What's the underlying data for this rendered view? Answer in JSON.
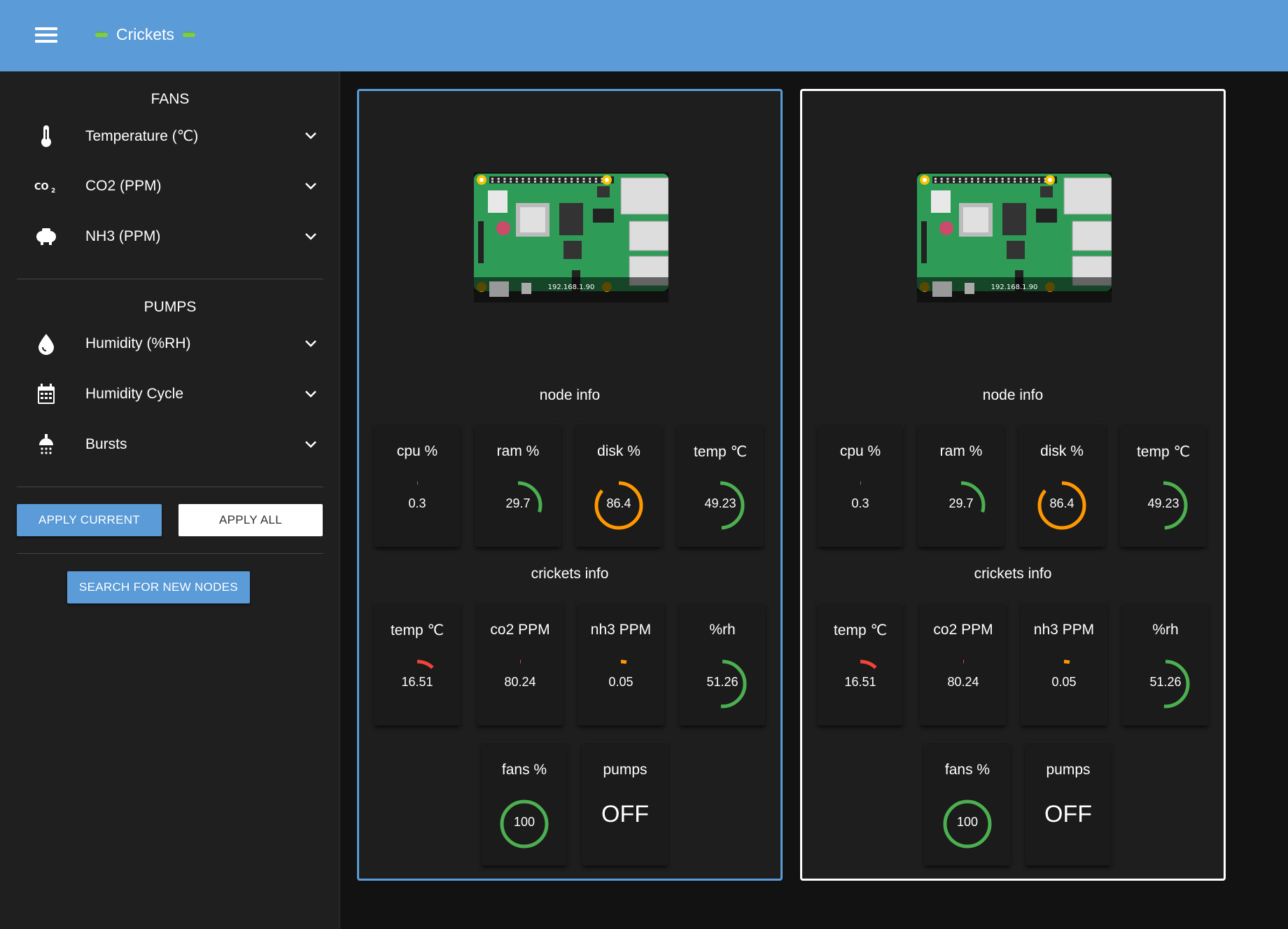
{
  "app": {
    "title": "Crickets"
  },
  "sidebar": {
    "fans_title": "FANS",
    "fans": [
      {
        "label": "Temperature (℃)",
        "icon": "thermometer-icon"
      },
      {
        "label": "CO2 (PPM)",
        "icon": "co2-icon"
      },
      {
        "label": "NH3 (PPM)",
        "icon": "nh3-gas-icon"
      }
    ],
    "pumps_title": "PUMPS",
    "pumps": [
      {
        "label": "Humidity (%RH)",
        "icon": "water-drop-icon"
      },
      {
        "label": "Humidity Cycle",
        "icon": "calendar-icon"
      },
      {
        "label": "Bursts",
        "icon": "sprinkler-icon"
      }
    ],
    "apply_current": "APPLY CURRENT",
    "apply_all": "APPLY ALL",
    "search_nodes": "SEARCH FOR NEW NODES"
  },
  "colors": {
    "accent": "#5a9bd8",
    "green": "#4caf50",
    "orange": "#ff9800",
    "red": "#f44336"
  },
  "nodes": [
    {
      "ip": "192.168.1.90",
      "node_info_title": "node info",
      "crickets_info_title": "crickets info",
      "node_info": [
        {
          "label": "cpu %",
          "value": "0.3",
          "fraction": 0.003,
          "color": "#4caf50"
        },
        {
          "label": "ram %",
          "value": "29.7",
          "fraction": 0.297,
          "color": "#4caf50"
        },
        {
          "label": "disk %",
          "value": "86.4",
          "fraction": 0.864,
          "color": "#ff9800"
        },
        {
          "label": "temp ℃",
          "value": "49.23",
          "fraction": 0.49,
          "color": "#4caf50"
        }
      ],
      "crickets_info": [
        {
          "label": "temp ℃",
          "value": "16.51",
          "fraction": 0.12,
          "color": "#f44336"
        },
        {
          "label": "co2 PPM",
          "value": "80.24",
          "fraction": 0.005,
          "color": "#f44336"
        },
        {
          "label": "nh3 PPM",
          "value": "0.05",
          "fraction": 0.04,
          "color": "#ff9800"
        },
        {
          "label": "%rh",
          "value": "51.26",
          "fraction": 0.51,
          "color": "#4caf50"
        }
      ],
      "fans": {
        "label": "fans %",
        "value": "100",
        "fraction": 1.0,
        "color": "#4caf50"
      },
      "pumps": {
        "label": "pumps",
        "state": "OFF"
      }
    },
    {
      "ip": "192.168.1.90",
      "node_info_title": "node info",
      "crickets_info_title": "crickets info",
      "node_info": [
        {
          "label": "cpu %",
          "value": "0.3",
          "fraction": 0.003,
          "color": "#4caf50"
        },
        {
          "label": "ram %",
          "value": "29.7",
          "fraction": 0.297,
          "color": "#4caf50"
        },
        {
          "label": "disk %",
          "value": "86.4",
          "fraction": 0.864,
          "color": "#ff9800"
        },
        {
          "label": "temp ℃",
          "value": "49.23",
          "fraction": 0.49,
          "color": "#4caf50"
        }
      ],
      "crickets_info": [
        {
          "label": "temp ℃",
          "value": "16.51",
          "fraction": 0.12,
          "color": "#f44336"
        },
        {
          "label": "co2 PPM",
          "value": "80.24",
          "fraction": 0.005,
          "color": "#f44336"
        },
        {
          "label": "nh3 PPM",
          "value": "0.05",
          "fraction": 0.04,
          "color": "#ff9800"
        },
        {
          "label": "%rh",
          "value": "51.26",
          "fraction": 0.51,
          "color": "#4caf50"
        }
      ],
      "fans": {
        "label": "fans %",
        "value": "100",
        "fraction": 1.0,
        "color": "#4caf50"
      },
      "pumps": {
        "label": "pumps",
        "state": "OFF"
      }
    }
  ]
}
